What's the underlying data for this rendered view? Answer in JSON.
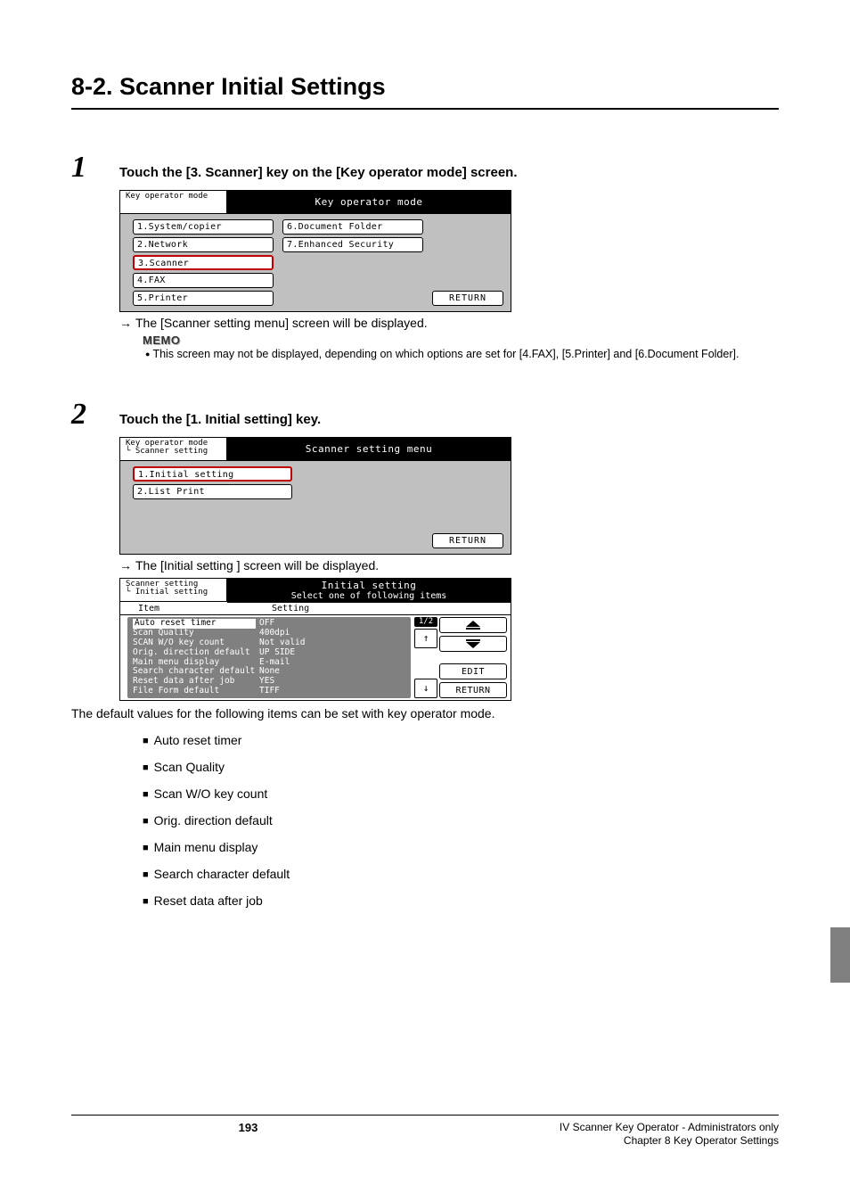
{
  "title": "8-2. Scanner Initial Settings",
  "step1": {
    "num": "1",
    "text": "Touch the [3. Scanner] key on the [Key operator mode] screen.",
    "screen": {
      "tab": "Key operator mode",
      "title": "Key operator mode",
      "left": [
        "1.System/copier",
        "2.Network",
        "3.Scanner",
        "4.FAX",
        "5.Printer"
      ],
      "right": [
        "6.Document Folder",
        "7.Enhanced Security"
      ],
      "return": "RETURN"
    },
    "result": "The [Scanner setting menu] screen will be displayed.",
    "memo": {
      "label": "MEMO",
      "text": "This screen may not be displayed, depending on which options are set for [4.FAX], [5.Printer] and [6.Document Folder]."
    }
  },
  "step2": {
    "num": "2",
    "text": "Touch the [1. Initial setting] key.",
    "screen": {
      "tab1": "Key operator mode",
      "tab2": "Scanner setting",
      "title": "Scanner setting menu",
      "left": [
        "1.Initial setting",
        "2.List Print"
      ],
      "return": "RETURN"
    },
    "result": "The [Initial setting ] screen will be displayed.",
    "screen3": {
      "tab1": "Scanner setting",
      "tab2": "Initial setting",
      "title": "Initial setting",
      "subtitle": "Select one of following items",
      "col1": "Item",
      "col2": "Setting",
      "page": "1/2",
      "items": [
        {
          "name": "Auto reset timer",
          "val": "OFF",
          "selected": true
        },
        {
          "name": "Scan Quality",
          "val": "400dpi"
        },
        {
          "name": "SCAN W/O key count",
          "val": "Not valid"
        },
        {
          "name": "Orig. direction default",
          "val": "UP SIDE"
        },
        {
          "name": "Main menu display",
          "val": "E-mail"
        },
        {
          "name": "Search character default",
          "val": "None"
        },
        {
          "name": "Reset data after job",
          "val": "YES"
        },
        {
          "name": "File Form default",
          "val": "TIFF"
        }
      ],
      "edit": "EDIT",
      "return": "RETURN"
    }
  },
  "body_text": "The default values for the following items can be set with key operator mode.",
  "bullets": [
    "Auto reset timer",
    "Scan Quality",
    "Scan W/O key count",
    "Orig. direction default",
    "Main menu display",
    "Search character default",
    "Reset data after job"
  ],
  "footer": {
    "page": "193",
    "line1": "IV Scanner Key Operator - Administrators only",
    "line2": "Chapter 8 Key Operator Settings"
  }
}
